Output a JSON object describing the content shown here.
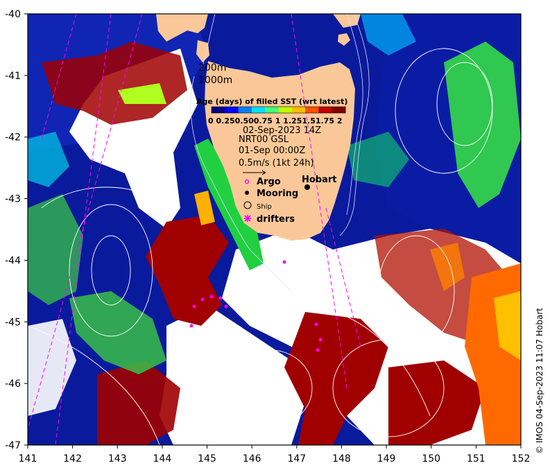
{
  "map": {
    "x_ticks": [
      "141",
      "142",
      "143",
      "144",
      "145",
      "146",
      "147",
      "148",
      "149",
      "150",
      "151",
      "152"
    ],
    "y_ticks": [
      "-40",
      "-41",
      "-42",
      "-43",
      "-44",
      "-45",
      "-46",
      "-47"
    ],
    "lon_range": [
      141,
      152
    ],
    "lat_range": [
      -47,
      -40
    ]
  },
  "legend": {
    "depth_200": "200m",
    "depth_1000": "1000m",
    "colorbar_title": "Age (days) of filled SST (wrt latest)",
    "colorbar_ticks": [
      "0",
      "0.25",
      "0.50",
      "0.75",
      "1",
      "1.25",
      "1.5",
      "1.75",
      "2"
    ],
    "colorbar_tick_text": "0  0.250.500.75  1  1.251.51.75  2",
    "colorbar_colors": [
      "#000088",
      "#0000ff",
      "#0080ff",
      "#00e0ff",
      "#40ff80",
      "#c0ff00",
      "#ffc000",
      "#ff5000",
      "#c00000",
      "#800000"
    ],
    "sst_date": "02-Sep-2023 14Z",
    "current_source": "NRT00 GSL",
    "current_date": "01-Sep 00:00Z",
    "vector_scale": "0.5m/s (1kt 24h)",
    "argo": "Argo",
    "mooring": "Mooring",
    "ship": "Ship",
    "drifters": "drifters",
    "drifters_suffix": "",
    "city": "Hobart"
  },
  "credit": "© IMOS 04-Sep-2023 11:07 Hobart",
  "colors": {
    "land": "#fac898",
    "ocean_base": "#0a1a9c",
    "ocean_mid": "#1432c8",
    "no_data": "#ffffff",
    "old_data": "#a00000",
    "argo": "#ff00ff",
    "drifter_track": "#ff00ff"
  }
}
